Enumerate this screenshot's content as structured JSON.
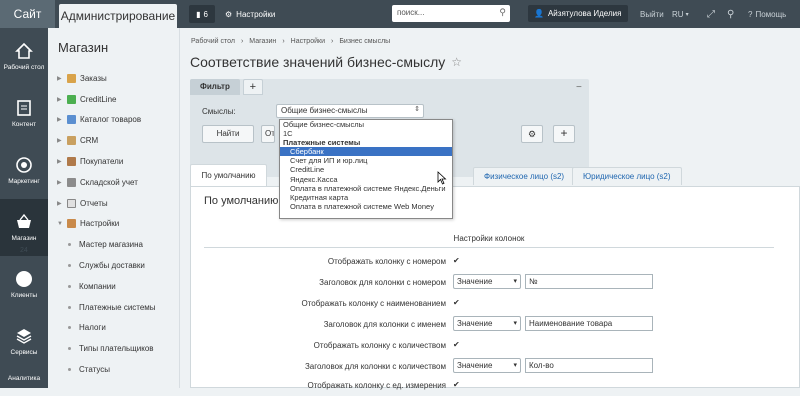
{
  "topbar": {
    "site_tab": "Сайт",
    "admin_tab": "Администрирование",
    "notifications_count": "6",
    "settings_label": "Настройки",
    "search_placeholder": "поиск...",
    "user_name": "Айзятулова Иделия",
    "logout_label": "Выйти",
    "language": "RU",
    "help_label": "Помощь"
  },
  "iconbar": {
    "items": [
      {
        "label": "Рабочий стол"
      },
      {
        "label": "Контент"
      },
      {
        "label": "Маркетинг"
      },
      {
        "label": "Магазин"
      },
      {
        "label": "Клиенты",
        "badge": "24"
      },
      {
        "label": "Сервисы"
      },
      {
        "label": "Аналитика"
      }
    ]
  },
  "menu": {
    "title": "Магазин",
    "items": [
      {
        "label": "Заказы"
      },
      {
        "label": "CreditLine"
      },
      {
        "label": "Каталог товаров"
      },
      {
        "label": "CRM"
      },
      {
        "label": "Покупатели"
      },
      {
        "label": "Складской учет"
      },
      {
        "label": "Отчеты"
      },
      {
        "label": "Настройки"
      }
    ],
    "subitems": [
      {
        "label": "Мастер магазина"
      },
      {
        "label": "Службы доставки"
      },
      {
        "label": "Компании"
      },
      {
        "label": "Платежные системы"
      },
      {
        "label": "Налоги"
      },
      {
        "label": "Типы плательщиков"
      },
      {
        "label": "Статусы"
      }
    ]
  },
  "breadcrumb": [
    "Рабочий стол",
    "Магазин",
    "Настройки",
    "Бизнес смыслы"
  ],
  "page_title": "Соответствие значений бизнес-смыслу",
  "filter": {
    "tab_label": "Фильтр",
    "field_label": "Смыслы:",
    "selected_value": "Общие бизнес-смыслы",
    "find_button": "Найти",
    "reset_button": "Отменить"
  },
  "dropdown": {
    "items": [
      {
        "label": "Общие бизнес-смыслы",
        "kind": "option"
      },
      {
        "label": "1С",
        "kind": "option"
      },
      {
        "label": "Платежные системы",
        "kind": "group"
      },
      {
        "label": "Сбербанк",
        "kind": "child",
        "selected": true
      },
      {
        "label": "Счет для ИП и юр.лиц",
        "kind": "child"
      },
      {
        "label": "CreditLine",
        "kind": "child"
      },
      {
        "label": "Яндекс.Касса",
        "kind": "child"
      },
      {
        "label": "Оплата в платежной системе Яндекс.Деньги",
        "kind": "child"
      },
      {
        "label": "Кредитная карта",
        "kind": "child"
      },
      {
        "label": "Оплата в платежной системе Web Money",
        "kind": "child"
      }
    ]
  },
  "tabs": {
    "default": "По умолчанию",
    "physical": "Физическое лицо (s2)",
    "legal": "Юридическое лицо (s2)"
  },
  "content": {
    "title": "По умолчанию",
    "section_heading": "Настройки колонок",
    "rows": [
      {
        "label": "Отображать колонку с номером",
        "type": "checkbox"
      },
      {
        "label": "Заголовок для колонки с номером",
        "type": "select",
        "select": "Значение",
        "value": "№"
      },
      {
        "label": "Отображать колонку с наименованием",
        "type": "checkbox"
      },
      {
        "label": "Заголовок для колонки с именем",
        "type": "select",
        "select": "Значение",
        "value": "Наименование товара"
      },
      {
        "label": "Отображать колонку с количеством",
        "type": "checkbox"
      },
      {
        "label": "Заголовок для колонки с количеством",
        "type": "select",
        "select": "Значение",
        "value": "Кол-во"
      },
      {
        "label": "Отображать колонку с ед. измерения",
        "type": "checkbox"
      }
    ]
  },
  "colors": {
    "topbar": "#3f4b54",
    "accent_blue": "#3a72c4",
    "link_blue": "#2067b0"
  }
}
